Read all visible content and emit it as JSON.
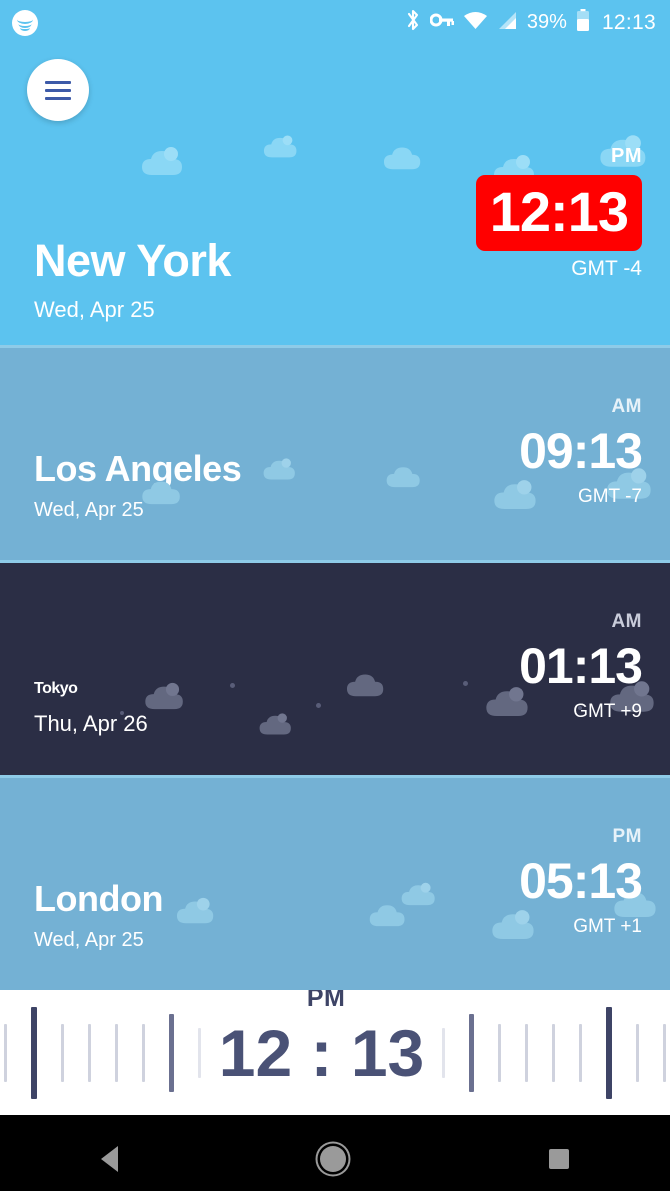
{
  "statusbar": {
    "app_icon": "spotify-icon",
    "bluetooth_icon": "bluetooth-icon",
    "vpn_icon": "vpn-key-icon",
    "wifi_icon": "wifi-icon",
    "signal_icon": "cellular-signal-icon",
    "battery_percent": "39%",
    "battery_icon": "battery-icon",
    "clock": "12:13"
  },
  "menu": {
    "icon": "hamburger-menu-icon",
    "label": "Menu"
  },
  "cities": [
    {
      "name": "New York",
      "date": "Wed, Apr 25",
      "time": "12:13",
      "ampm": "PM",
      "gmt": "GMT -4",
      "theme": "day-highlight",
      "highlight_color": "#ff0000",
      "bg_color": "#5cc3ef"
    },
    {
      "name": "Los Angeles",
      "date": "Wed, Apr 25",
      "time": "09:13",
      "ampm": "AM",
      "gmt": "GMT -7",
      "theme": "day",
      "bg_color": "#74b1d4"
    },
    {
      "name": "Tokyo",
      "date": "Thu, Apr 26",
      "time": "01:13",
      "ampm": "AM",
      "gmt": "GMT +9",
      "theme": "night",
      "bg_color": "#2b2e45"
    },
    {
      "name": "London",
      "date": "Wed, Apr 25",
      "time": "05:13",
      "ampm": "PM",
      "gmt": "GMT +1",
      "theme": "day",
      "bg_color": "#74b1d4"
    }
  ],
  "ruler": {
    "time": "12 : 13",
    "ampm": "PM",
    "text_color": "#4a5276"
  },
  "navbar": {
    "back_icon": "back-triangle-icon",
    "home_icon": "home-circle-icon",
    "recents_icon": "recents-square-icon"
  }
}
